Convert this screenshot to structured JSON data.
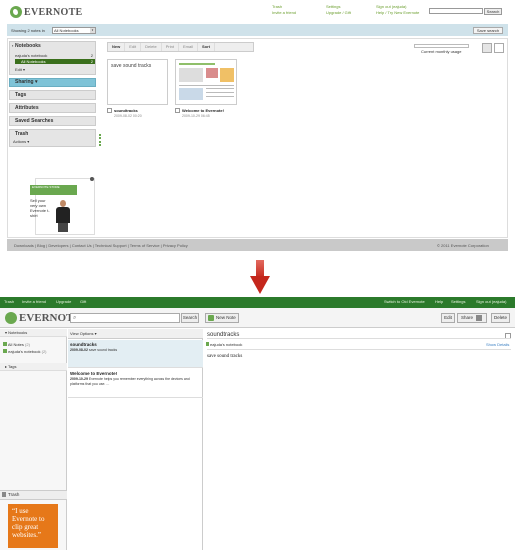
{
  "old": {
    "logo": "EVERNOTE",
    "links": {
      "trash": "Trash",
      "invite": "Invite a friend",
      "settings": "Settings",
      "upgrade": "Upgrade / Gift",
      "signout": "Sign out (eajuda)",
      "help": "Help / Try New Evernote",
      "search_btn": "Search"
    },
    "showing_label": "Showing 2 notes in",
    "notebook_select": "All Notebooks",
    "save_search": "Save search",
    "sidebar": {
      "notebooks": "Notebooks",
      "nb1": "eajuda's notebook",
      "nb1_count": "2",
      "all": "All Notebooks",
      "all_count": "2",
      "edit": "Edit",
      "sharing": "Sharing",
      "tags": "Tags",
      "attributes": "Attributes",
      "saved": "Saved Searches",
      "trash": "Trash",
      "actions": "Actions"
    },
    "ad": {
      "store": "EVERNOTE STORE",
      "text": "Sell your very own Evernote t-shirt"
    },
    "toolbar": [
      "New",
      "Edit",
      "Delete",
      "Print",
      "Email",
      "Sort"
    ],
    "usage": "Current monthly usage",
    "notes": [
      {
        "preview": "save sound tracks",
        "title": "soundtracks",
        "date": "2009-08-02 00:20"
      },
      {
        "title": "Welcome to Evernote!",
        "date": "2009-10-29 06:45"
      }
    ],
    "footer": "Downloads | Blog | Developers | Contact Us | Technical Support | Terms of Service | Privacy Policy",
    "copyright": "© 2011 Evernote Corporation"
  },
  "new": {
    "top": {
      "trash": "Trash",
      "invite": "Invite a friend",
      "upgrade": "Upgrade",
      "gift": "Gift",
      "old": "Switch to Old Evernote",
      "help": "Help",
      "settings": "Settings",
      "signout": "Sign out (eajuda)"
    },
    "logo": "EVERNOTE",
    "search_btn": "Search",
    "new_note": "New Note",
    "edit": "Edit",
    "share": "Share",
    "delete": "Delete",
    "notebooks": "Notebooks",
    "all_notes": "All Notes",
    "all_count": "(2)",
    "nb1": "eajuda's notebook",
    "nb1_count": "(2)",
    "tags": "Tags",
    "view_options": "View Options",
    "list": [
      {
        "title": "soundtracks",
        "date": "2009-08-02",
        "snippet": "save sound tracks"
      },
      {
        "title": "Welcome to Evernote!",
        "date": "2009-10-29",
        "snippet": "Evernote helps you remember everything across the devices and platforms that you use. ..."
      }
    ],
    "detail": {
      "title": "soundtracks",
      "notebook": "eajuda's notebook",
      "show": "Show Details",
      "body": "save sound tracks"
    },
    "trash": "Trash",
    "promo": "“I use Evernote to clip great websites.”"
  }
}
